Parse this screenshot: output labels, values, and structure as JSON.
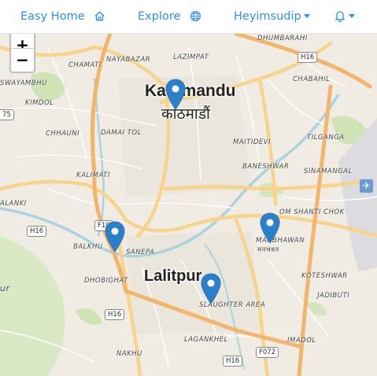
{
  "nav": {
    "home_label": "Easy Home",
    "explore_label": "Explore",
    "user_label": "Heyimsudip"
  },
  "zoom": {
    "in_label": "+",
    "out_label": "−"
  },
  "map": {
    "cities": {
      "kathmandu": "Kathmandu",
      "kathmandu_devanagari": "काठमाडौं",
      "lalitpur": "Lalitpur"
    },
    "areas": {
      "dhumbarahi": "DHUMBARAHI",
      "chamati": "CHAMATI",
      "nayabazar": "NAYABAZAR",
      "lazimpat": "LAZIMPAT",
      "swayambhu": "SWAYAMBHU",
      "chabahil": "CHABAHIL",
      "kimdol": "KIMDOL",
      "chhauni": "CHHAUNI",
      "damai_tol": "DAMAI TOL",
      "maitidevi": "MAITIDEVI",
      "tilganga": "TILGANGA",
      "baneshwar": "BANESHWAR",
      "kalimati": "KALIMATI",
      "sinamangal": "SINAMANGAL",
      "kalanki": "ALANKI",
      "om_shanti_chok": "OM SHANTI CHOK",
      "balkhu": "BALKHU",
      "sanepa": "SANEPA",
      "manbhawan": "MANBHAWAN",
      "manbhawan_devanagari": "मनभवन",
      "dhobighat": "DHOBIGHAT",
      "koteshwar": "KOTESHWAR",
      "slaughter_area": "SLAUGHTER AREA",
      "jadibuti": "JADIBUTI",
      "laganakhel": "LAGANKHEL",
      "imadol": "IMADOL",
      "nakhu": "NAKHU",
      "left_cut": "ur"
    },
    "shields": {
      "h16a": "H16",
      "s75": "75",
      "h16b": "H16",
      "f10": "F10",
      "h16c": "H16",
      "h16d": "H16",
      "f072": "F072"
    },
    "marker_color": "#2a81cb"
  }
}
